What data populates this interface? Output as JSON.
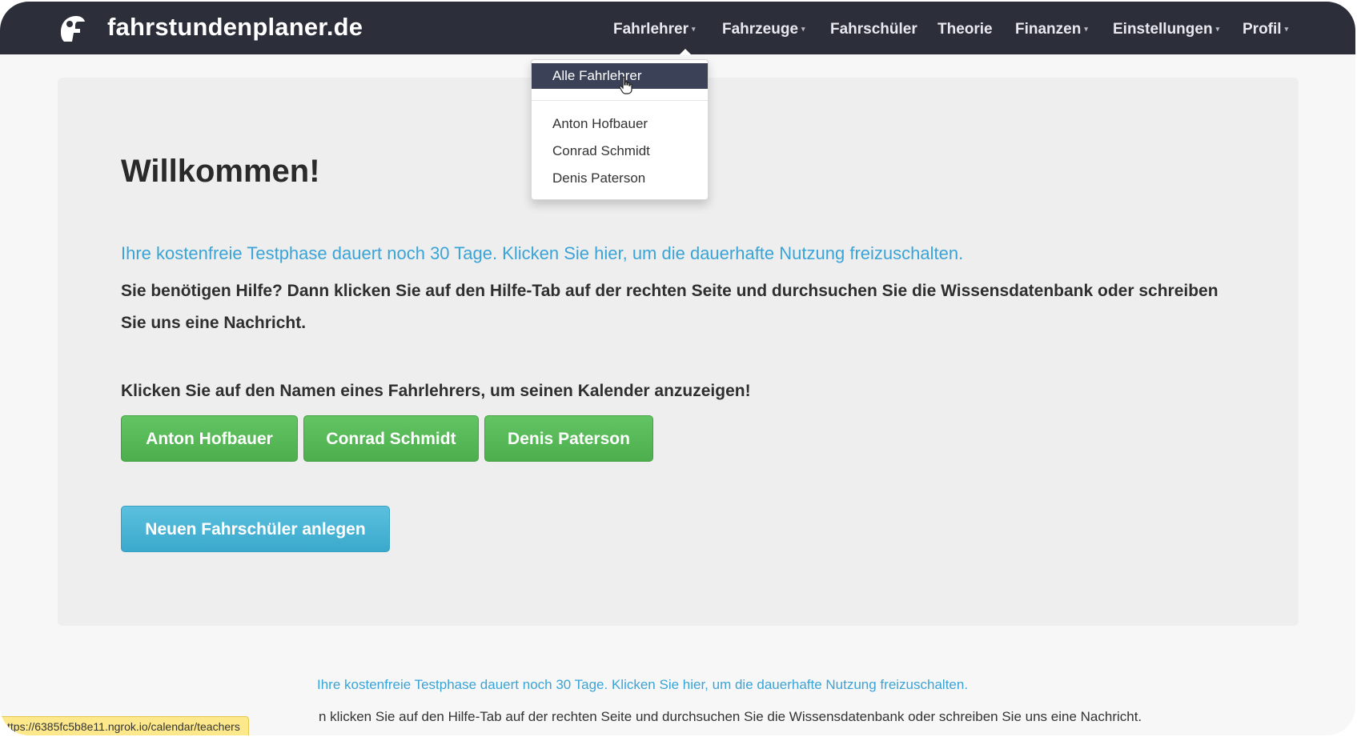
{
  "brand": {
    "name": "fahrstundenplaner.de",
    "logo_icon": "helmet-logo-icon"
  },
  "nav": {
    "items": [
      {
        "label": "Fahrlehrer",
        "has_caret": true
      },
      {
        "label": "Fahrzeuge",
        "has_caret": true
      },
      {
        "label": "Fahrschüler",
        "has_caret": false
      },
      {
        "label": "Theorie",
        "has_caret": false
      },
      {
        "label": "Finanzen",
        "has_caret": true
      },
      {
        "label": "Einstellungen",
        "has_caret": true
      },
      {
        "label": "Profil",
        "has_caret": true
      }
    ],
    "caret_glyph": "▾"
  },
  "dropdown": {
    "active_item": "Alle Fahrlehrer",
    "items": [
      "Anton Hofbauer",
      "Conrad Schmidt",
      "Denis Paterson"
    ]
  },
  "main": {
    "title": "Willkommen!",
    "trial_link": "Ihre kostenfreie Testphase dauert noch 30 Tage. Klicken Sie hier, um die dauerhafte Nutzung freizuschalten.",
    "help_text": "Sie benötigen Hilfe? Dann klicken Sie auf den Hilfe-Tab auf der rechten Seite und durchsuchen Sie die Wissensdatenbank oder schreiben Sie uns eine Nachricht.",
    "click_prompt": "Klicken Sie auf den Namen eines Fahrlehrers, um seinen Kalender anzuzeigen!",
    "teacher_buttons": [
      "Anton Hofbauer",
      "Conrad Schmidt",
      "Denis Paterson"
    ],
    "new_student_button": "Neuen Fahrschüler anlegen"
  },
  "footer": {
    "trial_link": "Ihre kostenfreie Testphase dauert noch 30 Tage. Klicken Sie hier, um die dauerhafte Nutzung freizuschalten.",
    "help_text": "n klicken Sie auf den Hilfe-Tab auf der rechten Seite und durchsuchen Sie die Wissensdatenbank oder schreiben Sie uns eine Nachricht."
  },
  "status_bar": {
    "url": "ttps://6385fc5b8e11.ngrok.io/calendar/teachers"
  },
  "colors": {
    "navbar": "#2c2f3a",
    "link": "#3aa4d6",
    "success": "#5cb85c",
    "info": "#5bc0de",
    "dropdown_active": "#3b4257"
  }
}
